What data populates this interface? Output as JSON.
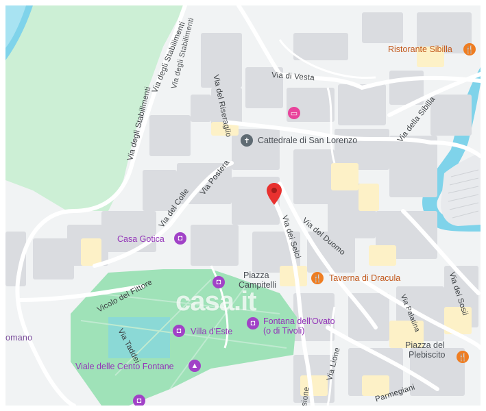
{
  "map": {
    "streets": [
      {
        "id": "via-di-vesta",
        "text": "Via di Vesta"
      },
      {
        "id": "via-del-riseraglio",
        "text": "Via del Riseraglio"
      },
      {
        "id": "via-degli-stabilimenti-1",
        "text": "Via degli Stabilimenti"
      },
      {
        "id": "via-degli-stabilimenti-2",
        "text": "Via degli Stabilimenti"
      },
      {
        "id": "via-degli-stabilimenti-3",
        "text": "Via degli Stabilimenti"
      },
      {
        "id": "via-della-sibilla",
        "text": "Via della Sibilla"
      },
      {
        "id": "via-postera",
        "text": "Via Postera"
      },
      {
        "id": "via-del-colle",
        "text": "Via del Colle"
      },
      {
        "id": "via-dei-selci",
        "text": "Via dei Selci"
      },
      {
        "id": "via-del-duomo",
        "text": "Via del Duomo"
      },
      {
        "id": "vicolo-del-fittore",
        "text": "Vicolo del Fittore"
      },
      {
        "id": "via-taddei",
        "text": "Via Taddei"
      },
      {
        "id": "via-palatina",
        "text": "Via Palatina"
      },
      {
        "id": "via-dei-sosii",
        "text": "Via dei Sosii"
      },
      {
        "id": "via-lione",
        "text": "Via Lione"
      },
      {
        "id": "parmegiani",
        "text": "Parmegiani"
      },
      {
        "id": "omano",
        "text": "omano"
      },
      {
        "id": "sione",
        "text": "sione"
      }
    ],
    "pois": {
      "ristorante_sibilla": "Ristorante Sibilla",
      "cattedrale": "Cattedrale di San Lorenzo",
      "casa_gotica": "Casa Gotica",
      "piazza_campitelli_1": "Piazza",
      "piazza_campitelli_2": "Campitelli",
      "taverna": "Taverna di Dracula",
      "fontana_1": "Fontana dell'Ovato",
      "fontana_2": "(o di Tivoli)",
      "villa_deste": "Villa d'Este",
      "viale_cento_fontane": "Viale delle Cento Fontane",
      "piazza_plebiscito_1": "Piazza del",
      "piazza_plebiscito_2": "Plebiscito"
    },
    "watermark": "casa.it",
    "colors": {
      "water": "#7fd3ea",
      "park": "#c8f0d6",
      "garden": "#9fe2b8",
      "buildings": "#dadce0",
      "roads": "#ffffff",
      "highlight": "#fdf1c7",
      "marker": "#e8312f"
    }
  }
}
